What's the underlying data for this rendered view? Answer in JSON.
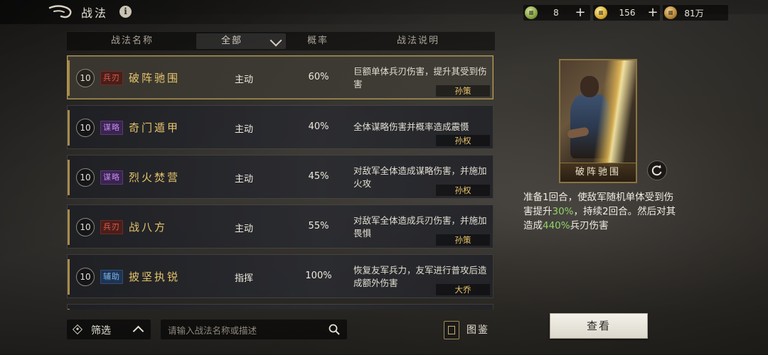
{
  "header": {
    "title": "战法",
    "info_icon": "i"
  },
  "currencies": [
    {
      "icon": "copper-coin-icon",
      "value": "8"
    },
    {
      "icon": "gold-coin-icon",
      "value": "156"
    },
    {
      "icon": "bronze-coin-icon",
      "value": "81万"
    }
  ],
  "plus_label": "+",
  "columns": {
    "name": "战法名称",
    "filter": "全部",
    "rate": "概率",
    "desc": "战法说明"
  },
  "skills": [
    {
      "level": "10",
      "tag": "兵刃",
      "name": "破阵驰围",
      "type": "主动",
      "rate": "60%",
      "desc": "巨额单体兵刃伤害，提升其受到伤害",
      "owner": "孙策",
      "selected": true
    },
    {
      "level": "10",
      "tag": "谋略",
      "name": "奇门遁甲",
      "type": "主动",
      "rate": "40%",
      "desc": "全体谋略伤害并概率造成震慑",
      "owner": "孙权"
    },
    {
      "level": "10",
      "tag": "谋略",
      "name": "烈火焚营",
      "type": "主动",
      "rate": "45%",
      "desc": "对敌军全体造成谋略伤害，并施加火攻",
      "owner": "孙权"
    },
    {
      "level": "10",
      "tag": "兵刃",
      "name": "战八方",
      "type": "主动",
      "rate": "55%",
      "desc": "对敌军全体造成兵刃伤害，并施加畏惧",
      "owner": "孙策"
    },
    {
      "level": "10",
      "tag": "辅助",
      "name": "披坚执锐",
      "type": "指挥",
      "rate": "100%",
      "desc": "恢复友军兵力，友军进行普攻后造成额外伤害",
      "owner": "大乔"
    }
  ],
  "bottom": {
    "filter_label": "筛选",
    "search_placeholder": "请输入战法名称或描述",
    "codex_label": "图鉴"
  },
  "detail": {
    "card_name": "破阵驰围",
    "line1": "准备1回合，使敌军随机单体受到伤害提升",
    "val1": "30%",
    "line2": "，持续2回合。然后对其造成",
    "val2": "440%",
    "line3": "兵刃伤害",
    "view_button": "查看"
  },
  "colors": {
    "accent_gold": "#e6c46a",
    "highlight_green": "#8fd46a",
    "tag_bing": "#e06050",
    "tag_mou": "#c48ae8",
    "tag_fu": "#7fb4ea"
  }
}
